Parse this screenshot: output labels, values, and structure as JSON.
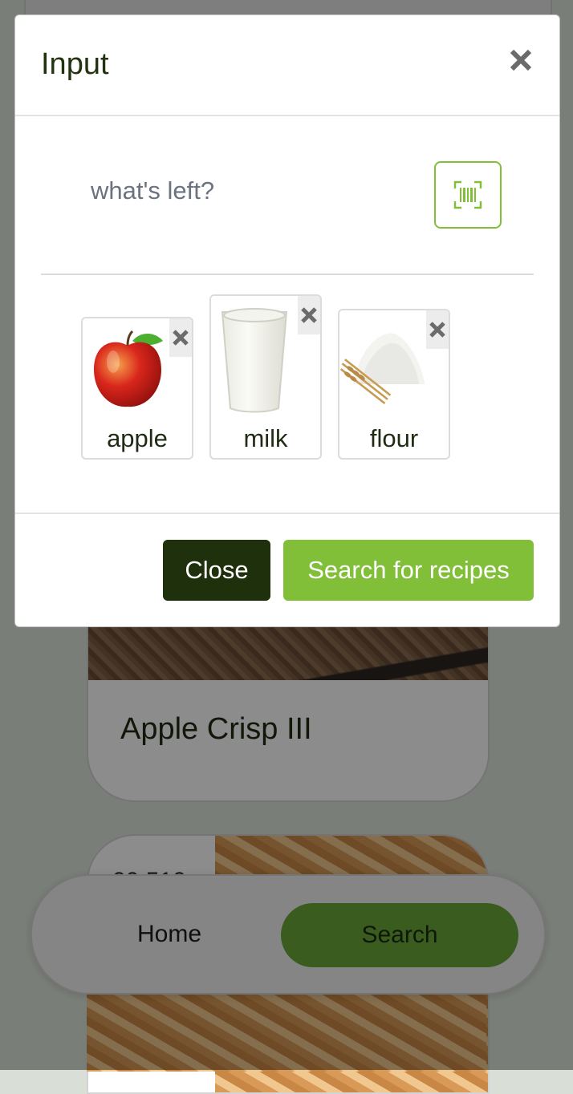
{
  "background": {
    "recipe_cards": [
      {
        "title": "Apple Crisp III"
      },
      {
        "side_text": "00.510"
      }
    ],
    "bottom_nav": {
      "items": [
        {
          "label": "Home",
          "active": false
        },
        {
          "label": "Search",
          "active": true
        }
      ]
    }
  },
  "modal": {
    "title": "Input",
    "close_icon": "close-icon",
    "search_input": {
      "value": "",
      "placeholder": "what's left?"
    },
    "scan_icon": "barcode-scan-icon",
    "ingredients": [
      {
        "label": "apple",
        "icon": "apple-image"
      },
      {
        "label": "milk",
        "icon": "milk-glass-image"
      },
      {
        "label": "flour",
        "icon": "flour-wheat-image"
      }
    ],
    "footer": {
      "close_label": "Close",
      "search_label": "Search for recipes"
    }
  },
  "colors": {
    "accent_green": "#82bf39",
    "dark_green": "#1f300c",
    "text_dark": "#22330f",
    "placeholder_gray": "#6b7280"
  }
}
